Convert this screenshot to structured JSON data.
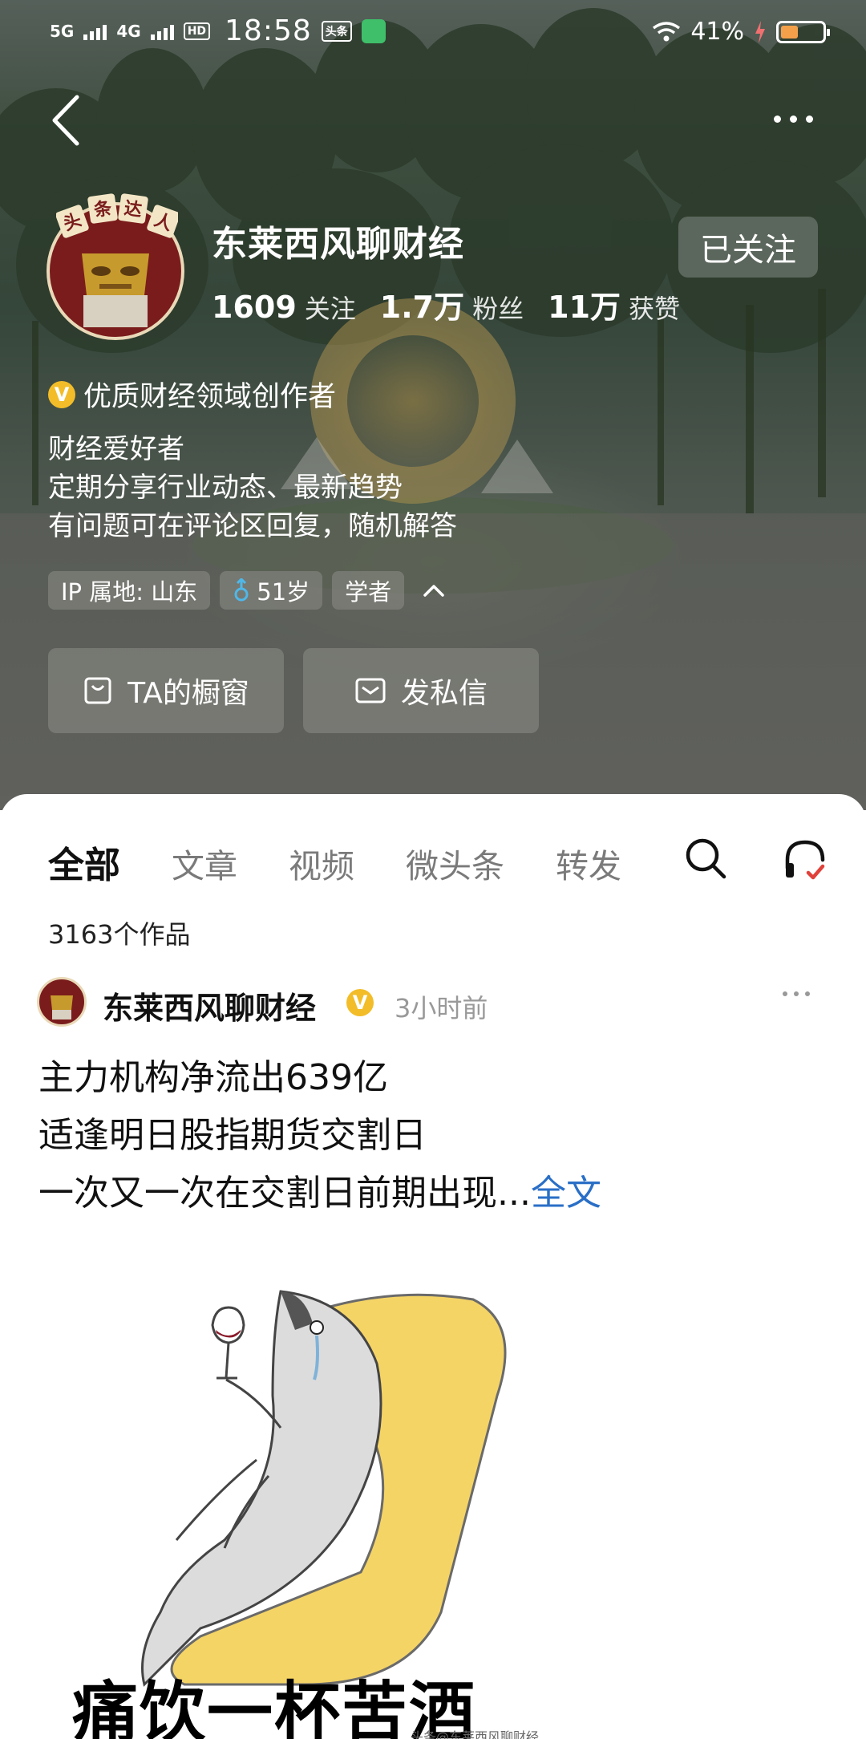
{
  "status_bar": {
    "network_1": "5G",
    "network_2": "4G",
    "hd_tag": "HD",
    "time": "18:58",
    "app_tag": "头条",
    "battery_percent": "41%",
    "battery_level": 0.41,
    "colors": {
      "battery_fill": "#f4a04a",
      "charging": "#f07070"
    }
  },
  "nav": {
    "back_icon": "chevron-left-icon",
    "more_icon": "more-horizontal-icon"
  },
  "profile": {
    "avatar_badge": [
      "头",
      "条",
      "达",
      "人"
    ],
    "name": "东莱西风聊财经",
    "follow_button": "已关注",
    "stats": [
      {
        "value": "1609",
        "label": "关注"
      },
      {
        "value": "1.7万",
        "label": "粉丝"
      },
      {
        "value": "11万",
        "label": "获赞"
      }
    ],
    "verified_badge": "V",
    "verification": "优质财经领域创作者",
    "bio": [
      "财经爱好者",
      "定期分享行业动态、最新趋势",
      "有问题可在评论区回复，随机解答"
    ],
    "tags": {
      "ip_location": "IP 属地: 山东",
      "age": "51岁",
      "occupation": "学者"
    },
    "buttons": {
      "shop_window": "TA的橱窗",
      "message": "发私信"
    },
    "colors": {
      "verified": "#f2bd28",
      "male_icon": "#4fb7e8"
    }
  },
  "tabs": {
    "items": [
      {
        "label": "全部",
        "active": true
      },
      {
        "label": "文章",
        "active": false
      },
      {
        "label": "视频",
        "active": false
      },
      {
        "label": "微头条",
        "active": false
      },
      {
        "label": "转发",
        "active": false
      }
    ],
    "search_icon": "search-icon",
    "listen_icon": "headphones-icon"
  },
  "works_count": "3163个作品",
  "post": {
    "author": "东莱西风聊财经",
    "verified_badge": "V",
    "time": "3小时前",
    "lines": [
      "主力机构净流出639亿",
      "适逢明日股指期货交割日",
      "一次又一次在交割日前期出现..."
    ],
    "full_text_link": "全文",
    "image_caption": "痛饮一杯苦酒",
    "image_watermark": "头条@东莱西风聊财经",
    "colors": {
      "link": "#2a6fc7"
    }
  }
}
